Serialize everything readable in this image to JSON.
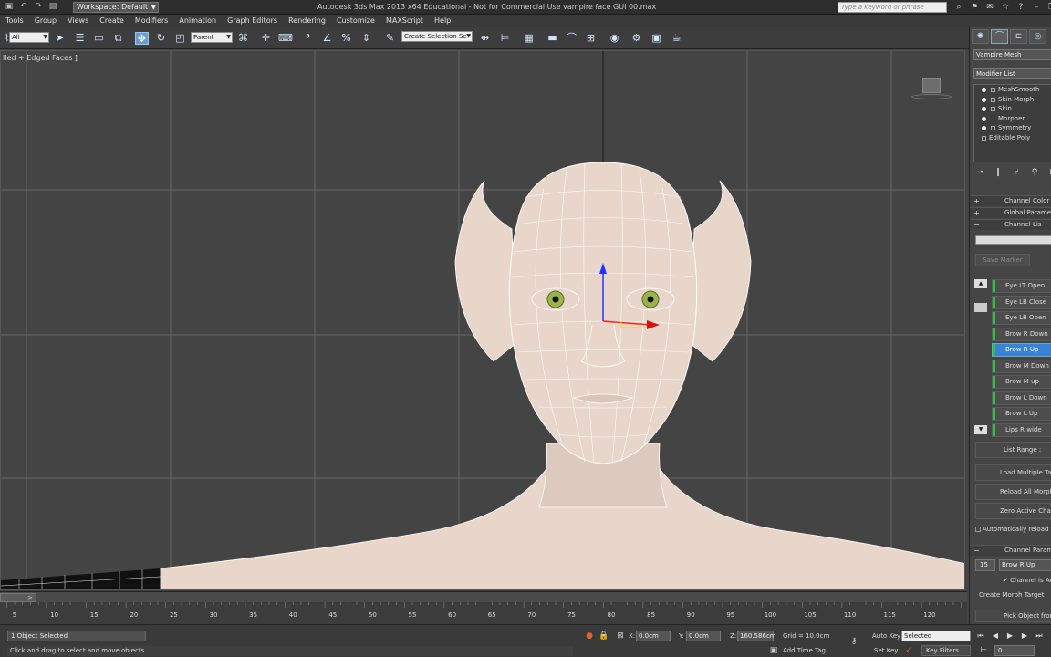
{
  "titlebar": {
    "workspace": "Workspace: Default",
    "title": "Autodesk 3ds Max  2013 x64   Educational - Not for Commercial Use    vampire face GUI 00.max",
    "search_placeholder": "Type a keyword or phrase"
  },
  "menu": [
    "Tools",
    "Group",
    "Views",
    "Create",
    "Modifiers",
    "Animation",
    "Graph Editors",
    "Rendering",
    "Customize",
    "MAXScript",
    "Help"
  ],
  "toolbar": {
    "selection_filter": "All",
    "reference_coord": "Parent",
    "named_selection": "Create Selection Se"
  },
  "viewport": {
    "label": "lled + Edged Faces ]",
    "bg_color": "#444444",
    "grid_color": "#666666",
    "mesh_color": "#e8d6cb"
  },
  "timeline": {
    "slider": ">",
    "ticks": [
      "5",
      "10",
      "15",
      "20",
      "25",
      "30",
      "35",
      "40",
      "45",
      "50",
      "55",
      "60",
      "65",
      "70",
      "75",
      "80",
      "85",
      "90",
      "95",
      "100",
      "105",
      "110",
      "115",
      "120"
    ]
  },
  "status": {
    "selection": "1 Object Selected",
    "prompt": "Click and drag to select and move objects",
    "x_label": "X:",
    "x_value": "0.0cm",
    "y_label": "Y:",
    "y_value": "0.0cm",
    "z_label": "Z:",
    "z_value": "160.586cm",
    "grid": "Grid = 10.0cm",
    "add_time_tag": "Add Time Tag",
    "auto_key": "Auto Key",
    "auto_key_mode": "Selected",
    "set_key": "Set Key",
    "key_filters": "Key Filters...",
    "frame": "0"
  },
  "cmdpanel": {
    "object_name": "Vampire Mesh",
    "modifier_list": "Modifier List",
    "stack": [
      "MeshSmooth",
      "Skin Morph",
      "Skin",
      "Morpher",
      "Symmetry"
    ],
    "stack_base": "Editable Poly",
    "rollouts": {
      "channel_color": "Channel Color Le",
      "global_params": "Global Parame",
      "channel_list": "Channel Lis",
      "channel_params": "Channel Param"
    },
    "save_marker": "Save Marker",
    "channels": [
      "Eye LT Open",
      "Eye LB Close",
      "Eye LB Open",
      "Brow R Down",
      "Brow R Up",
      "Brow M Down",
      "Brow M up",
      "Brow L Down",
      "Brow L Up",
      "Lips R wide"
    ],
    "selected_channel": 4,
    "list_range": "List Range :",
    "load_multiple": "Load Multiple Targ",
    "reload_all": "Reload All Morph T",
    "zero_active": "Zero Active Channe",
    "auto_reload": "Automatically reload tar",
    "channel_number": "15",
    "channel_name": "Brow R Up",
    "channel_active": "Channel is Act",
    "create_morph_target": "Create Morph Target",
    "pick_object": "Pick Object from",
    "accent_color": "#3a82d6",
    "channel_on_color": "#2ec040"
  }
}
